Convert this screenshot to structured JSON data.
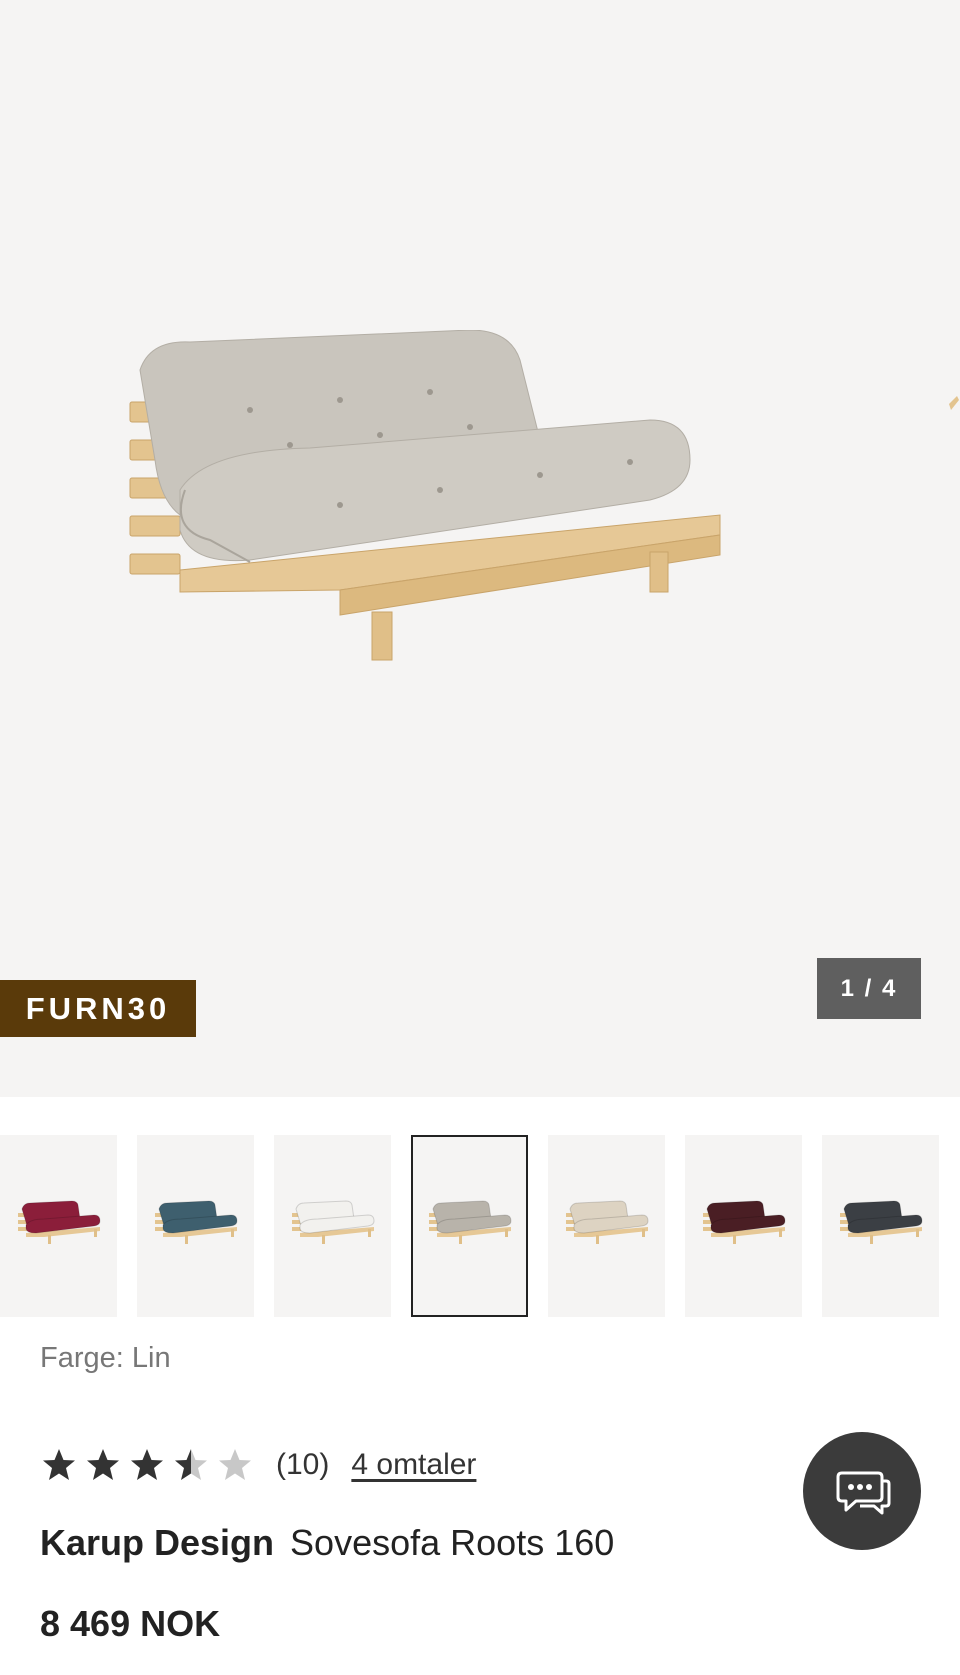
{
  "gallery": {
    "promo_code": "FURN30",
    "counter": "1 / 4",
    "image_alt": "Sovesofa Roots 160 i Lin"
  },
  "thumbnails": [
    {
      "color": "#8b1e3a",
      "selected": false
    },
    {
      "color": "#3e5f6e",
      "selected": false
    },
    {
      "color": "#f2f1ee",
      "selected": false
    },
    {
      "color": "#b8b3aa",
      "selected": true
    },
    {
      "color": "#ddd3c2",
      "selected": false
    },
    {
      "color": "#4a1e24",
      "selected": false
    },
    {
      "color": "#3b3f44",
      "selected": false
    }
  ],
  "product": {
    "color_label": "Farge: Lin",
    "rating": 3.5,
    "rating_max": 5,
    "rating_count": "(10)",
    "reviews_link": "4 omtaler",
    "brand": "Karup Design",
    "name": "Sovesofa Roots 160",
    "price": "8 469 NOK"
  },
  "icons": {
    "chat": "chat-bubbles-icon",
    "star": "star-icon"
  },
  "colors": {
    "promo_bg": "#5a3a0a",
    "counter_bg": "#5f5f5f",
    "chat_bg": "#3b3b3b",
    "wood": "#e6c896",
    "fabric": "#c9c5bd"
  }
}
